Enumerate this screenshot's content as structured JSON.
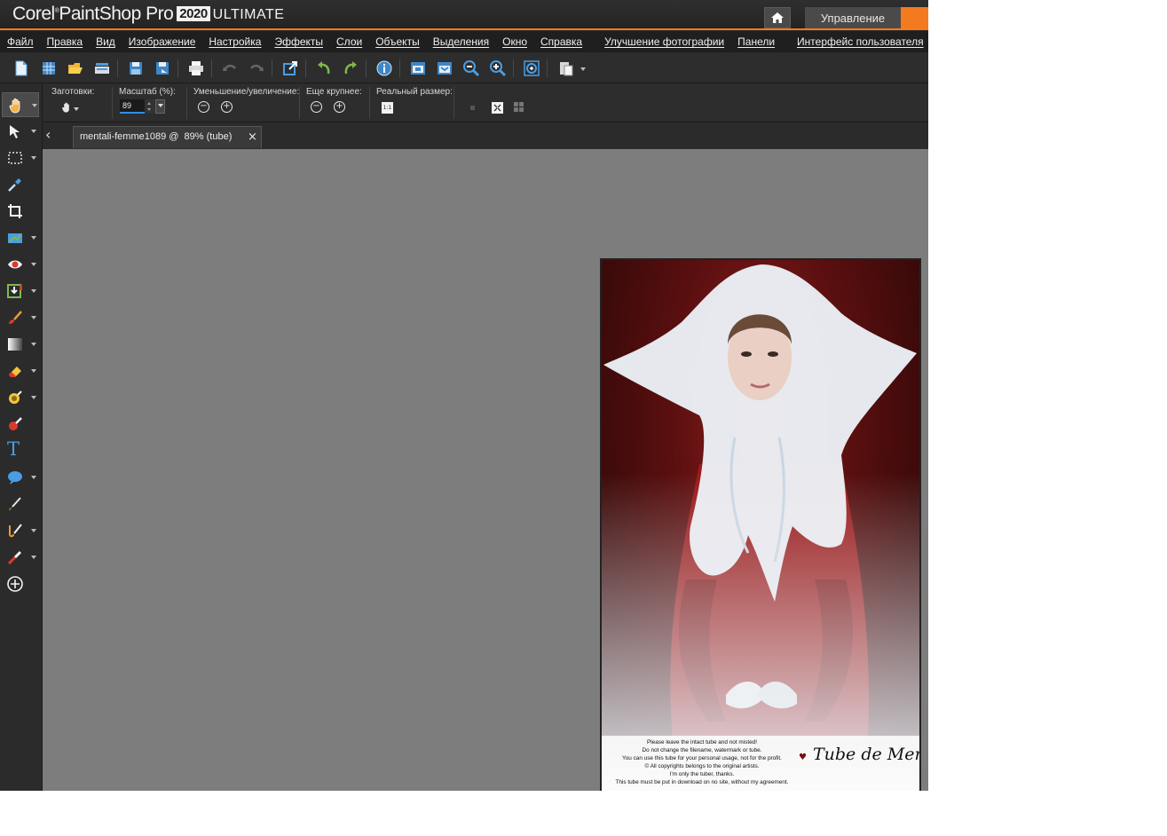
{
  "titlebar": {
    "brand_corel": "Corel",
    "brand_product": "PaintShop Pro",
    "brand_year": "2020",
    "brand_edition": "ULTIMATE",
    "home_icon": "home-icon",
    "manage_tab": "Управление",
    "accent_color": "#f47a1f"
  },
  "menu": {
    "items": [
      "Файл",
      "Правка",
      "Вид",
      "Изображение",
      "Настройка",
      "Эффекты",
      "Слои",
      "Объекты",
      "Выделения",
      "Окно",
      "Справка"
    ],
    "extra": [
      "Улучшение фотографии",
      "Панели"
    ],
    "ui": "Интерфейс пользователя"
  },
  "toolbar": {
    "icons": [
      "new-file-icon",
      "new-from-template-icon",
      "open-icon",
      "scan-icon",
      "save-icon",
      "save-as-icon",
      "print-icon",
      "undo-icon",
      "redo-icon",
      "resize-icon",
      "rotate-left-icon",
      "rotate-right-icon",
      "info-icon",
      "fit-window-icon",
      "fit-screen-icon",
      "zoom-out-icon",
      "zoom-in-icon",
      "zoom-actual-icon",
      "paste-icon"
    ]
  },
  "options": {
    "presets_label": "Заготовки:",
    "zoom_label": "Масштаб (%):",
    "zoom_value": "89",
    "zoom_inout_label": "Уменьшение/увеличение:",
    "zoom_more_label": "Еще крупнее:",
    "actual_size_label": "Реальный размер:",
    "actual_size_btn": "1:1",
    "minus": "−",
    "plus": "+"
  },
  "toolbox": {
    "tools": [
      "pan-tool-icon",
      "pick-tool-icon",
      "selection-tool-icon",
      "dropper-tool-icon",
      "crop-tool-icon",
      "straighten-tool-icon",
      "red-eye-tool-icon",
      "smart-fill-tool-icon",
      "paint-brush-tool-icon",
      "gradient-fill-tool-icon",
      "eraser-tool-icon",
      "dodge-tool-icon",
      "color-replacer-tool-icon",
      "text-tool-icon",
      "preset-shape-tool-icon",
      "pen-tool-icon",
      "art-brush-tool-icon",
      "retouch-tool-icon",
      "add-tools-icon"
    ],
    "text_glyph": "T"
  },
  "document": {
    "tab_label": "mentali-femme1089 @  89% (tube)",
    "close_glyph": "×",
    "back_glyph": "‹",
    "footer_lines": [
      "Please leave the intact tube and not misted!",
      "Do not change the filename, watermark or tube.",
      "You can use this tube for your personal usage, not for the profit.",
      "© All copyrights belongs to the original artists.",
      "I'm only the tuber, thanks.",
      "This tube must be put in download on no site, without my agreement."
    ],
    "signature": "Tube de Mentali"
  }
}
